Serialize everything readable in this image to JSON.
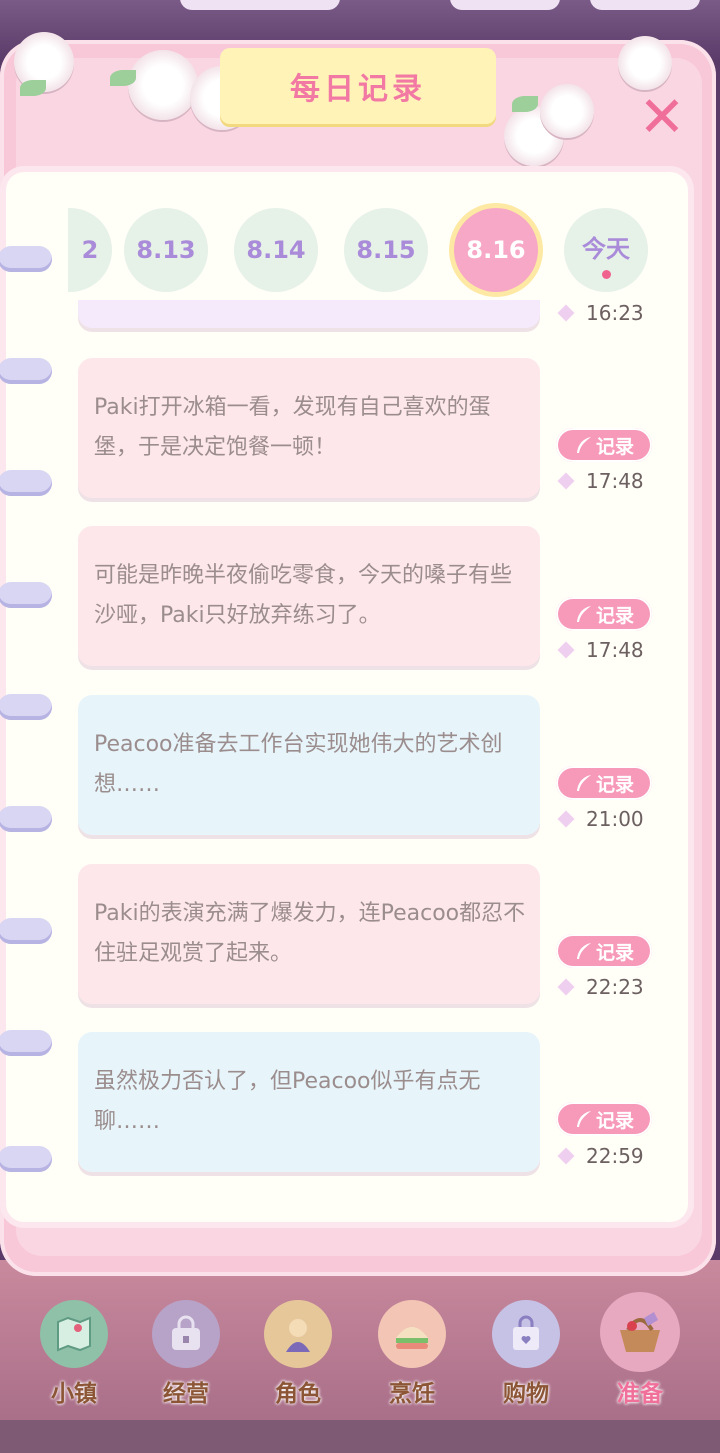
{
  "header": {
    "title": "每日记录",
    "close_label": "✕"
  },
  "dates": [
    {
      "label": "2",
      "active": false
    },
    {
      "label": "8.13",
      "active": false
    },
    {
      "label": "8.14",
      "active": false
    },
    {
      "label": "8.15",
      "active": false
    },
    {
      "label": "8.16",
      "active": true
    },
    {
      "label": "今天",
      "active": false,
      "has_dot": true
    }
  ],
  "partial_entry": {
    "time": "16:23"
  },
  "entries": [
    {
      "text": "Paki打开冰箱一看，发现有自己喜欢的蛋堡，于是决定饱餐一顿！",
      "button": "记录",
      "time": "17:48",
      "color": "#fde7ea"
    },
    {
      "text": "可能是昨晚半夜偷吃零食，今天的嗓子有些沙哑，Paki只好放弃练习了。",
      "button": "记录",
      "time": "17:48",
      "color": "#fde7ea"
    },
    {
      "text": "Peacoo准备去工作台实现她伟大的艺术创想……",
      "button": "记录",
      "time": "21:00",
      "color": "#e7f5fb"
    },
    {
      "text": "Paki的表演充满了爆发力，连Peacoo都忍不住驻足观赏了起来。",
      "button": "记录",
      "time": "22:23",
      "color": "#fde7ea"
    },
    {
      "text": "虽然极力否认了，但Peacoo似乎有点无聊……",
      "button": "记录",
      "time": "22:59",
      "color": "#e7f5fb"
    }
  ],
  "nav": [
    {
      "label": "小镇",
      "icon": "map-icon",
      "active": false
    },
    {
      "label": "经营",
      "icon": "bag-lock-icon",
      "active": false
    },
    {
      "label": "角色",
      "icon": "character-icon",
      "active": false
    },
    {
      "label": "烹饪",
      "icon": "sandwich-icon",
      "active": false
    },
    {
      "label": "购物",
      "icon": "shopping-bag-icon",
      "active": false
    },
    {
      "label": "准备",
      "icon": "picnic-basket-icon",
      "active": true
    }
  ],
  "colors": {
    "accent_pink": "#f279a3",
    "date_text": "#a98bd9",
    "active_date": "#f7a8c6",
    "record_button": "#f79ab9"
  }
}
